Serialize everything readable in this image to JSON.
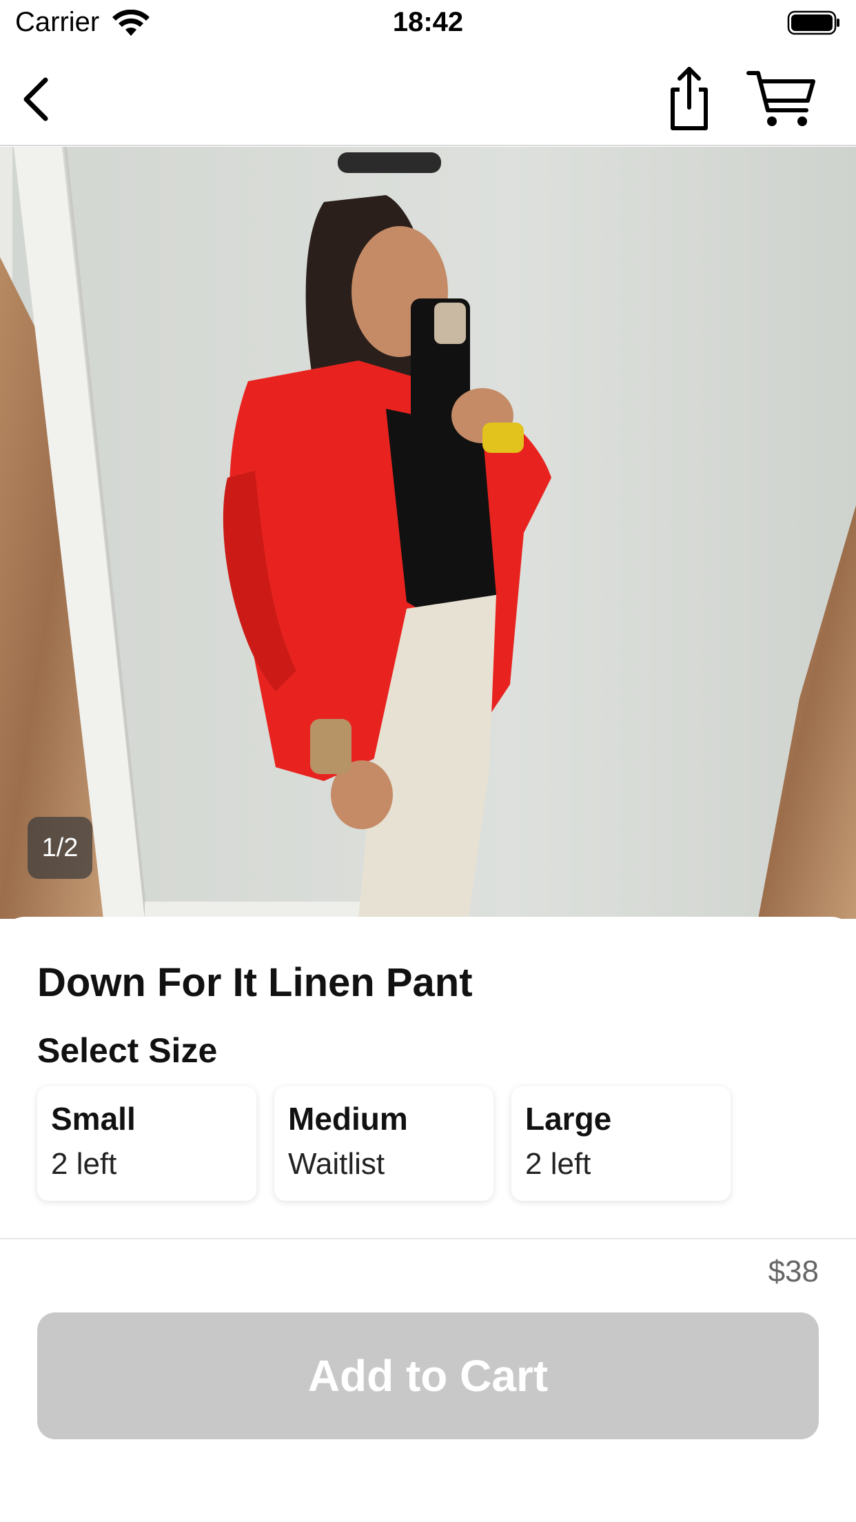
{
  "status_bar": {
    "carrier": "Carrier",
    "time": "18:42"
  },
  "nav": {
    "icons": [
      "back-chevron-icon",
      "share-icon",
      "cart-icon"
    ]
  },
  "gallery": {
    "counter": "1/2"
  },
  "product": {
    "title": "Down For It Linen Pant",
    "select_size_label": "Select Size",
    "sizes": [
      {
        "name": "Small",
        "stock": "2 left"
      },
      {
        "name": "Medium",
        "stock": "Waitlist"
      },
      {
        "name": "Large",
        "stock": "2 left"
      }
    ],
    "price": "$38",
    "add_to_cart_label": "Add to Cart"
  },
  "colors": {
    "button_disabled": "#c8c8c8",
    "jacket": "#e8231f"
  }
}
